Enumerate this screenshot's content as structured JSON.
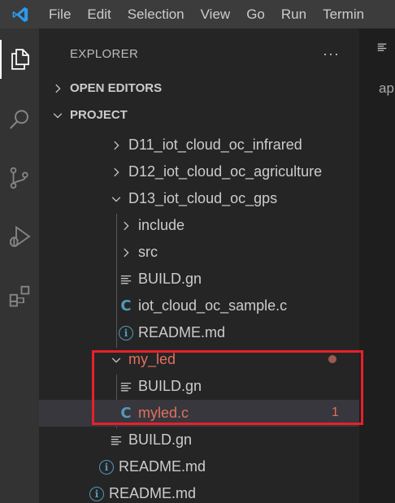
{
  "menubar": {
    "items": [
      "File",
      "Edit",
      "Selection",
      "View",
      "Go",
      "Run",
      "Termin"
    ]
  },
  "activitybar": {
    "icons": [
      "explorer-icon",
      "search-icon",
      "source-control-icon",
      "run-debug-icon",
      "extensions-icon"
    ]
  },
  "sidebar": {
    "title": "EXPLORER",
    "more": "···",
    "sections": {
      "open_editors": "OPEN EDITORS",
      "project": "PROJECT"
    },
    "tree": [
      {
        "label": "D11_iot_cloud_oc_infrared",
        "kind": "folder-collapsed"
      },
      {
        "label": "D12_iot_cloud_oc_agriculture",
        "kind": "folder-collapsed"
      },
      {
        "label": "D13_iot_cloud_oc_gps",
        "kind": "folder-expanded"
      },
      {
        "label": "include",
        "kind": "folder-collapsed"
      },
      {
        "label": "src",
        "kind": "folder-collapsed"
      },
      {
        "label": "BUILD.gn",
        "kind": "file-lines"
      },
      {
        "label": "iot_cloud_oc_sample.c",
        "kind": "file-c"
      },
      {
        "label": "README.md",
        "kind": "file-info"
      },
      {
        "label": "my_led",
        "kind": "folder-expanded",
        "modified": true
      },
      {
        "label": "BUILD.gn",
        "kind": "file-lines"
      },
      {
        "label": "myled.c",
        "kind": "file-c",
        "modified": true,
        "badge": "1",
        "selected": true
      },
      {
        "label": "BUILD.gn",
        "kind": "file-lines"
      },
      {
        "label": "README.md",
        "kind": "file-info"
      },
      {
        "label": "README.md",
        "kind": "file-info"
      }
    ]
  },
  "editor": {
    "tab_icon": "file-lines-icon",
    "breadcrumb": "ap"
  },
  "colors": {
    "accent_c_file": "#519aba",
    "modified": "#e2705d",
    "highlight_box": "#e8202a"
  }
}
